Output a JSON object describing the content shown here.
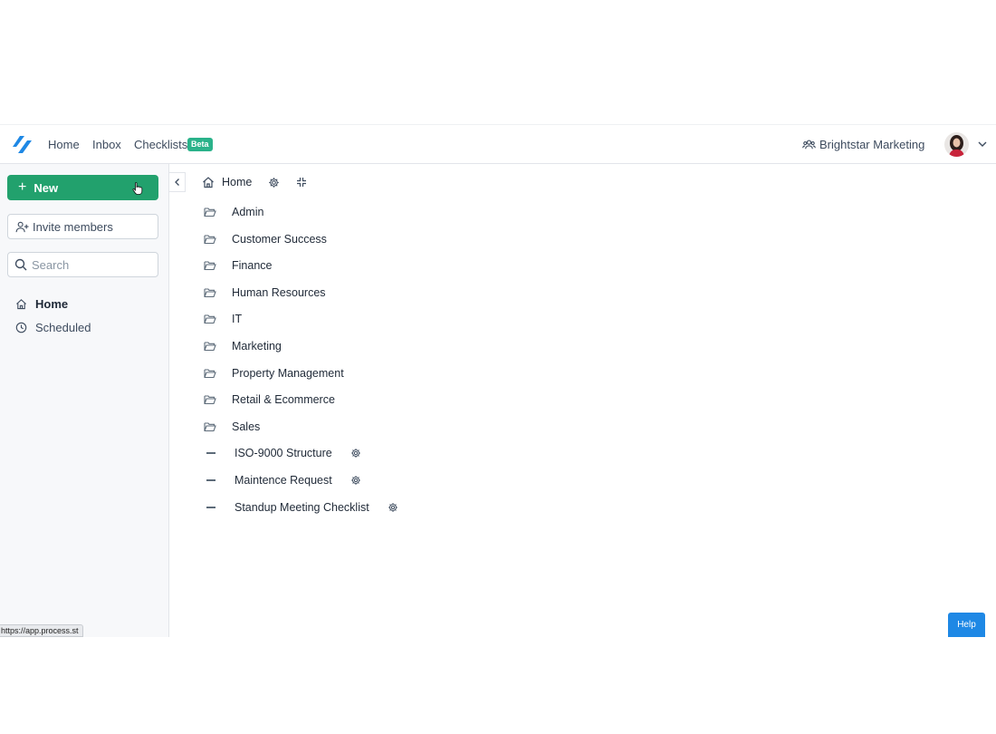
{
  "topbar": {
    "logo_icon": "process-street-logo-icon",
    "nav": [
      {
        "label": "Home"
      },
      {
        "label": "Inbox"
      },
      {
        "label": "Checklists"
      }
    ],
    "beta_badge": "Beta",
    "org_name": "Brightstar Marketing",
    "org_icon": "users-icon",
    "accent_color": "#2ab28a"
  },
  "sidebar": {
    "new_button": "New",
    "invite_button": "Invite members",
    "search_placeholder": "Search",
    "items": [
      {
        "label": "Home",
        "icon": "home-icon",
        "active": true
      },
      {
        "label": "Scheduled",
        "icon": "clock-icon",
        "active": false
      }
    ],
    "status_url": "https://app.process.st",
    "new_button_color": "#22a16d"
  },
  "main": {
    "breadcrumb": "Home",
    "folders": [
      "Admin",
      "Customer Success",
      "Finance",
      "Human Resources",
      "IT",
      "Marketing",
      "Property Management",
      "Retail & Ecommerce",
      "Sales"
    ],
    "workflows": [
      "ISO-9000 Structure",
      "Maintence Request",
      "Standup Meeting Checklist"
    ]
  },
  "help_button": "Help",
  "help_color": "#1e88e5"
}
